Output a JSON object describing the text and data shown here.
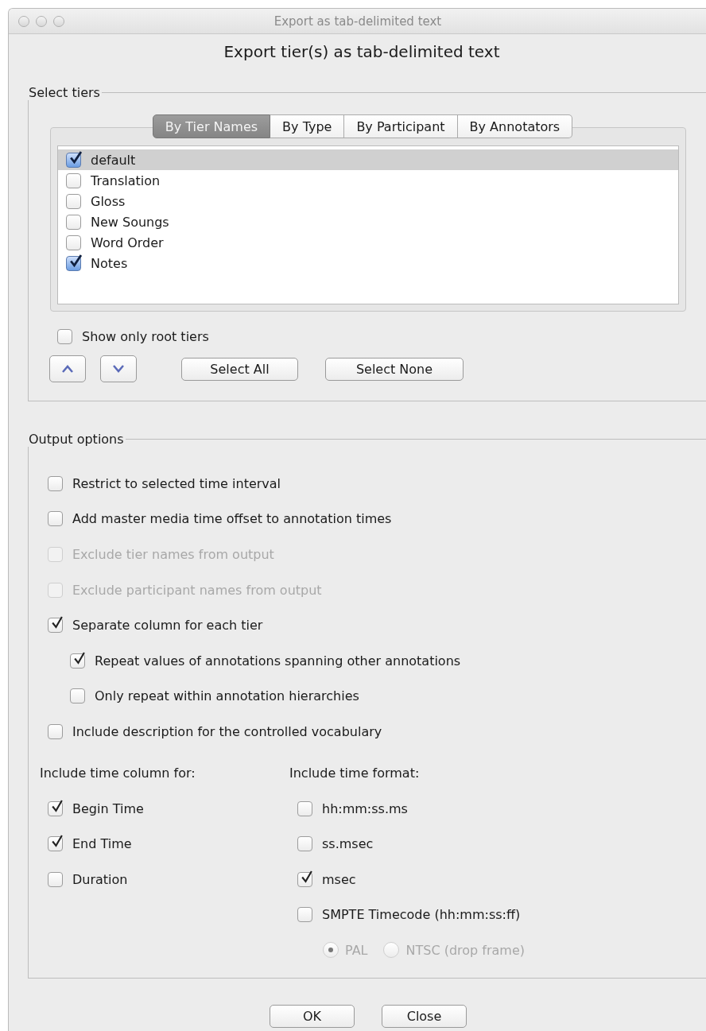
{
  "window": {
    "title": "Export as tab-delimited text"
  },
  "heading": "Export tier(s) as tab-delimited text",
  "select_tiers": {
    "legend": "Select tiers",
    "tabs": [
      {
        "label": "By Tier Names",
        "selected": true
      },
      {
        "label": "By Type",
        "selected": false
      },
      {
        "label": "By Participant",
        "selected": false
      },
      {
        "label": "By Annotators",
        "selected": false
      }
    ],
    "tiers": [
      {
        "name": "default",
        "checked": true,
        "selected": true
      },
      {
        "name": "Translation",
        "checked": false,
        "selected": false
      },
      {
        "name": "Gloss",
        "checked": false,
        "selected": false
      },
      {
        "name": "New Soungs",
        "checked": false,
        "selected": false
      },
      {
        "name": "Word Order",
        "checked": false,
        "selected": false
      },
      {
        "name": "Notes",
        "checked": true,
        "selected": false
      }
    ],
    "show_only_root_tiers": {
      "label": "Show only root tiers",
      "checked": false
    },
    "select_all": "Select All",
    "select_none": "Select None"
  },
  "output_options": {
    "legend": "Output options",
    "options": [
      {
        "label": "Restrict to selected time interval",
        "checked": false,
        "disabled": false
      },
      {
        "label": "Add master media time offset to annotation times",
        "checked": false,
        "disabled": false
      },
      {
        "label": "Exclude tier names from output",
        "checked": false,
        "disabled": true
      },
      {
        "label": "Exclude participant names from output",
        "checked": false,
        "disabled": true
      },
      {
        "label": "Separate column for each tier",
        "checked": true,
        "disabled": false,
        "children": [
          {
            "label": "Repeat values of annotations spanning other annotations",
            "checked": true,
            "disabled": false
          },
          {
            "label": "Only repeat within annotation hierarchies",
            "checked": false,
            "disabled": false
          }
        ]
      },
      {
        "label": "Include description for the controlled vocabulary",
        "checked": false,
        "disabled": false
      }
    ],
    "time_columns": {
      "heading": "Include time column for:",
      "items": [
        {
          "label": "Begin Time",
          "checked": true
        },
        {
          "label": "End Time",
          "checked": true
        },
        {
          "label": "Duration",
          "checked": false
        }
      ]
    },
    "time_formats": {
      "heading": "Include time format:",
      "items": [
        {
          "label": "hh:mm:ss.ms",
          "checked": false
        },
        {
          "label": "ss.msec",
          "checked": false
        },
        {
          "label": "msec",
          "checked": true
        },
        {
          "label": "SMPTE Timecode (hh:mm:ss:ff)",
          "checked": false
        }
      ],
      "frame_rates": [
        {
          "label": "PAL",
          "selected": true,
          "disabled": true
        },
        {
          "label": "NTSC (drop frame)",
          "selected": false,
          "disabled": true
        }
      ]
    }
  },
  "buttons": [
    "OK",
    "Close"
  ]
}
